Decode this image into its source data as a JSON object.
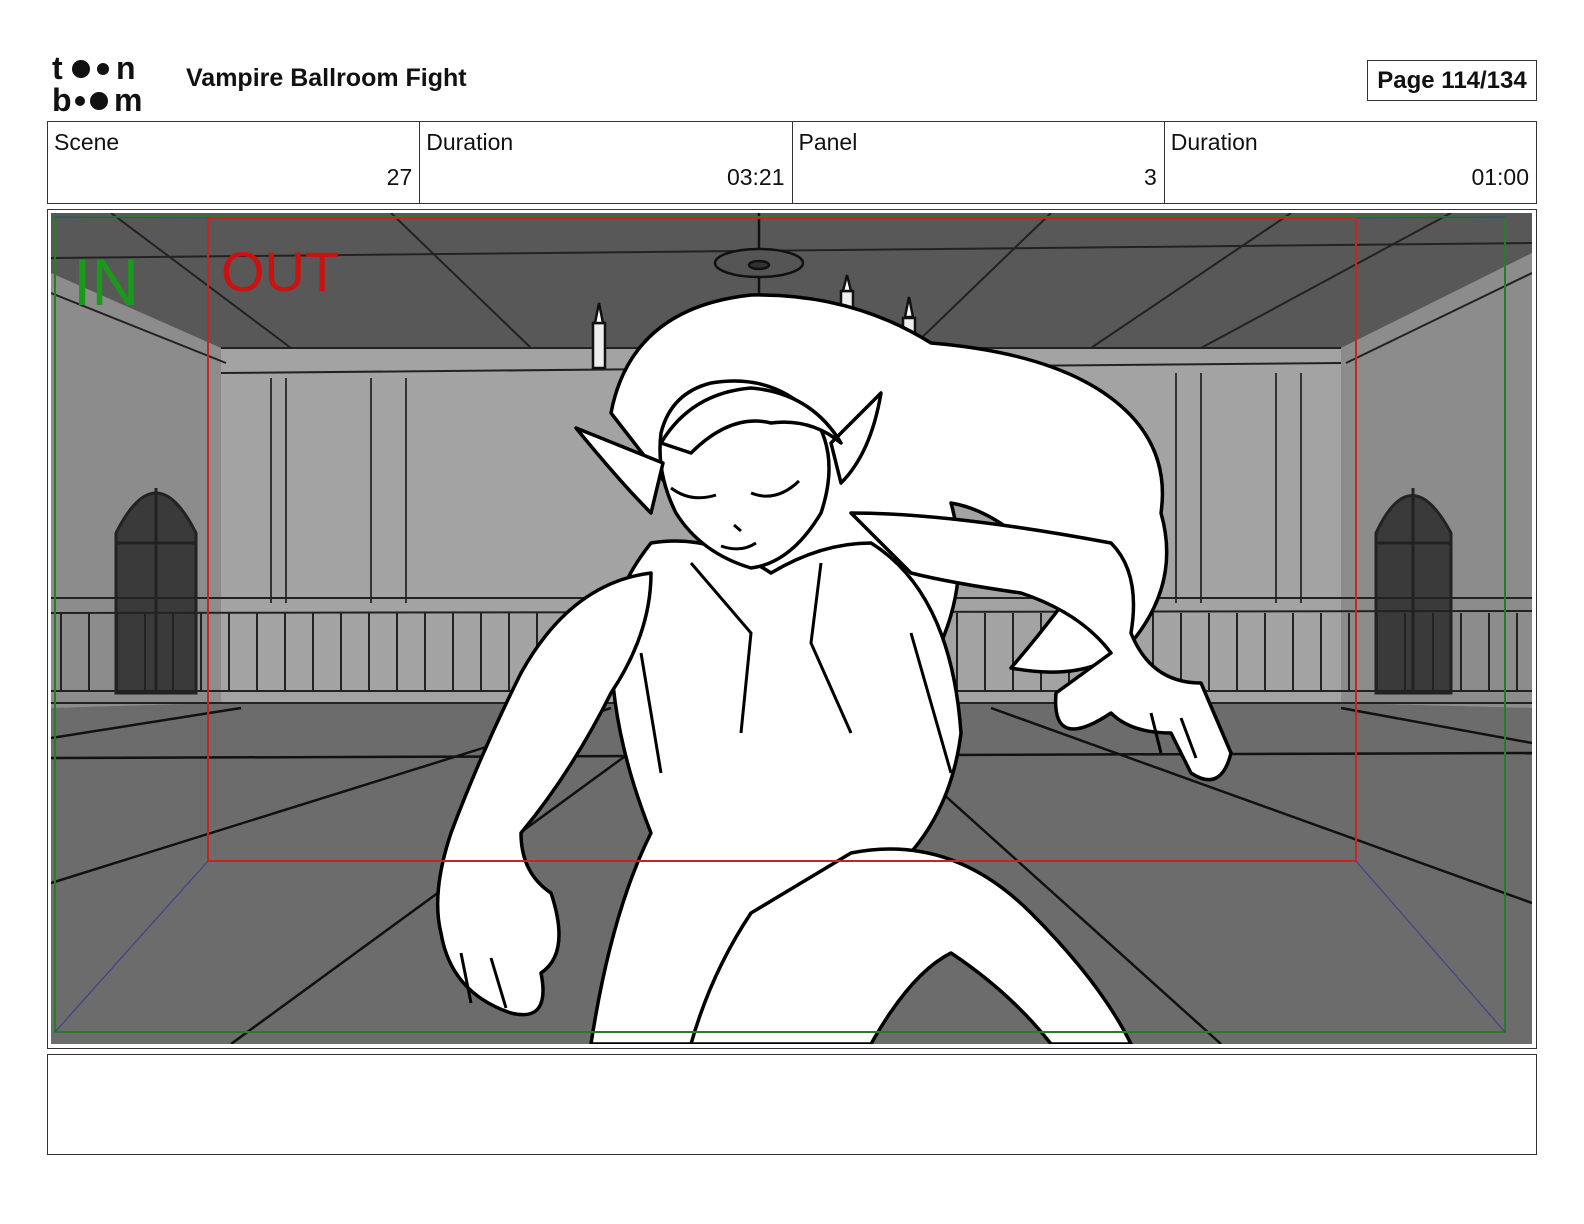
{
  "header": {
    "logo_line1": "toon",
    "logo_line2": "boom",
    "title": "Vampire Ballroom Fight",
    "page": "Page 114/134"
  },
  "info": {
    "scene_label": "Scene",
    "scene_value": "27",
    "scene_duration_label": "Duration",
    "scene_duration_value": "03:21",
    "panel_label": "Panel",
    "panel_value": "3",
    "panel_duration_label": "Duration",
    "panel_duration_value": "01:00"
  },
  "panel": {
    "in_label": "IN",
    "out_label": "OUT",
    "in_color": "#1a9a1a",
    "out_color": "#cc1111"
  },
  "notes": {
    "text": ""
  }
}
